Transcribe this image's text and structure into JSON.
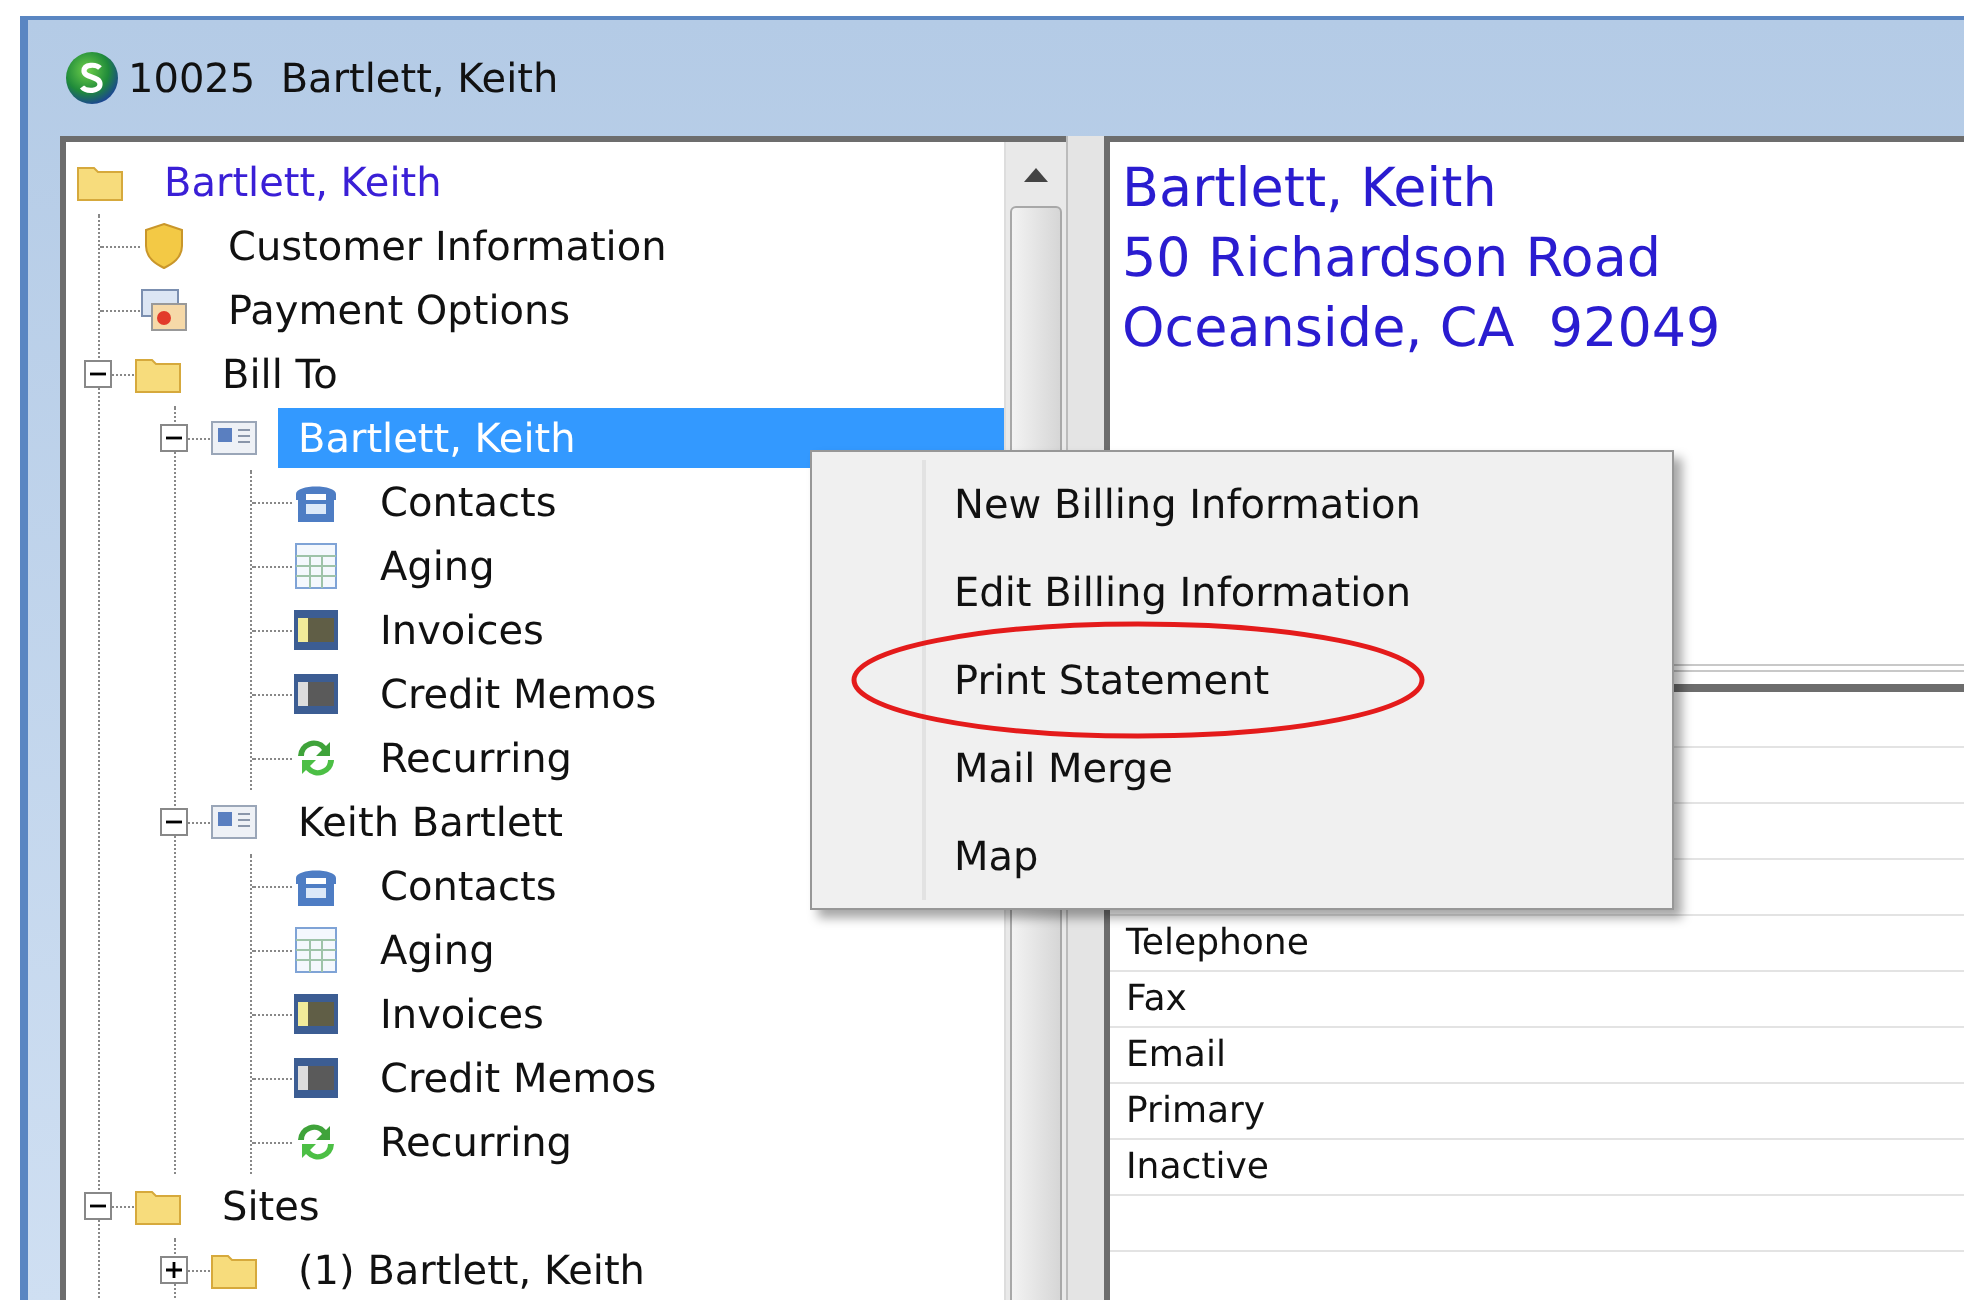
{
  "window": {
    "title": "10025  Bartlett, Keith"
  },
  "tree": [
    {
      "label": "Bartlett, Keith",
      "kind": "folder",
      "selected": false,
      "children": [
        {
          "label": "Customer Information",
          "kind": "shield",
          "selected": false
        },
        {
          "label": "Payment Options",
          "kind": "payment",
          "selected": false
        },
        {
          "label": "Bill To",
          "kind": "folder",
          "selected": false,
          "expanded": true,
          "children": [
            {
              "label": "Bartlett, Keith",
              "kind": "card",
              "selected": true,
              "expanded": true,
              "children": [
                {
                  "label": "Contacts",
                  "kind": "phone",
                  "selected": false
                },
                {
                  "label": "Aging",
                  "kind": "grid",
                  "selected": false
                },
                {
                  "label": "Invoices",
                  "kind": "film",
                  "selected": false
                },
                {
                  "label": "Credit Memos",
                  "kind": "film-dark",
                  "selected": false
                },
                {
                  "label": "Recurring",
                  "kind": "recycle",
                  "selected": false
                }
              ]
            },
            {
              "label": "Keith Bartlett",
              "kind": "card",
              "selected": false,
              "expanded": true,
              "children": [
                {
                  "label": "Contacts",
                  "kind": "phone",
                  "selected": false
                },
                {
                  "label": "Aging",
                  "kind": "grid",
                  "selected": false
                },
                {
                  "label": "Invoices",
                  "kind": "film",
                  "selected": false
                },
                {
                  "label": "Credit Memos",
                  "kind": "film-dark",
                  "selected": false
                },
                {
                  "label": "Recurring",
                  "kind": "recycle",
                  "selected": false
                }
              ]
            }
          ]
        },
        {
          "label": "Sites",
          "kind": "folder",
          "selected": false,
          "expanded": true,
          "children": [
            {
              "label": "(1) Bartlett, Keith",
              "kind": "folder",
              "selected": false,
              "expanded": false
            }
          ]
        }
      ]
    }
  ],
  "address": [
    "Bartlett, Keith",
    "50 Richardson Road",
    "Oceanside, CA  92049"
  ],
  "context_menu": [
    {
      "label": "New Billing Information",
      "highlighted": false
    },
    {
      "label": "Edit Billing Information",
      "highlighted": false
    },
    {
      "label": "Print Statement",
      "highlighted": true
    },
    {
      "label": "Mail Merge",
      "highlighted": false
    },
    {
      "label": "Map",
      "highlighted": false
    }
  ],
  "details": {
    "rows": [
      "Telephone",
      "Fax",
      "Email",
      "Primary",
      "Inactive"
    ]
  }
}
